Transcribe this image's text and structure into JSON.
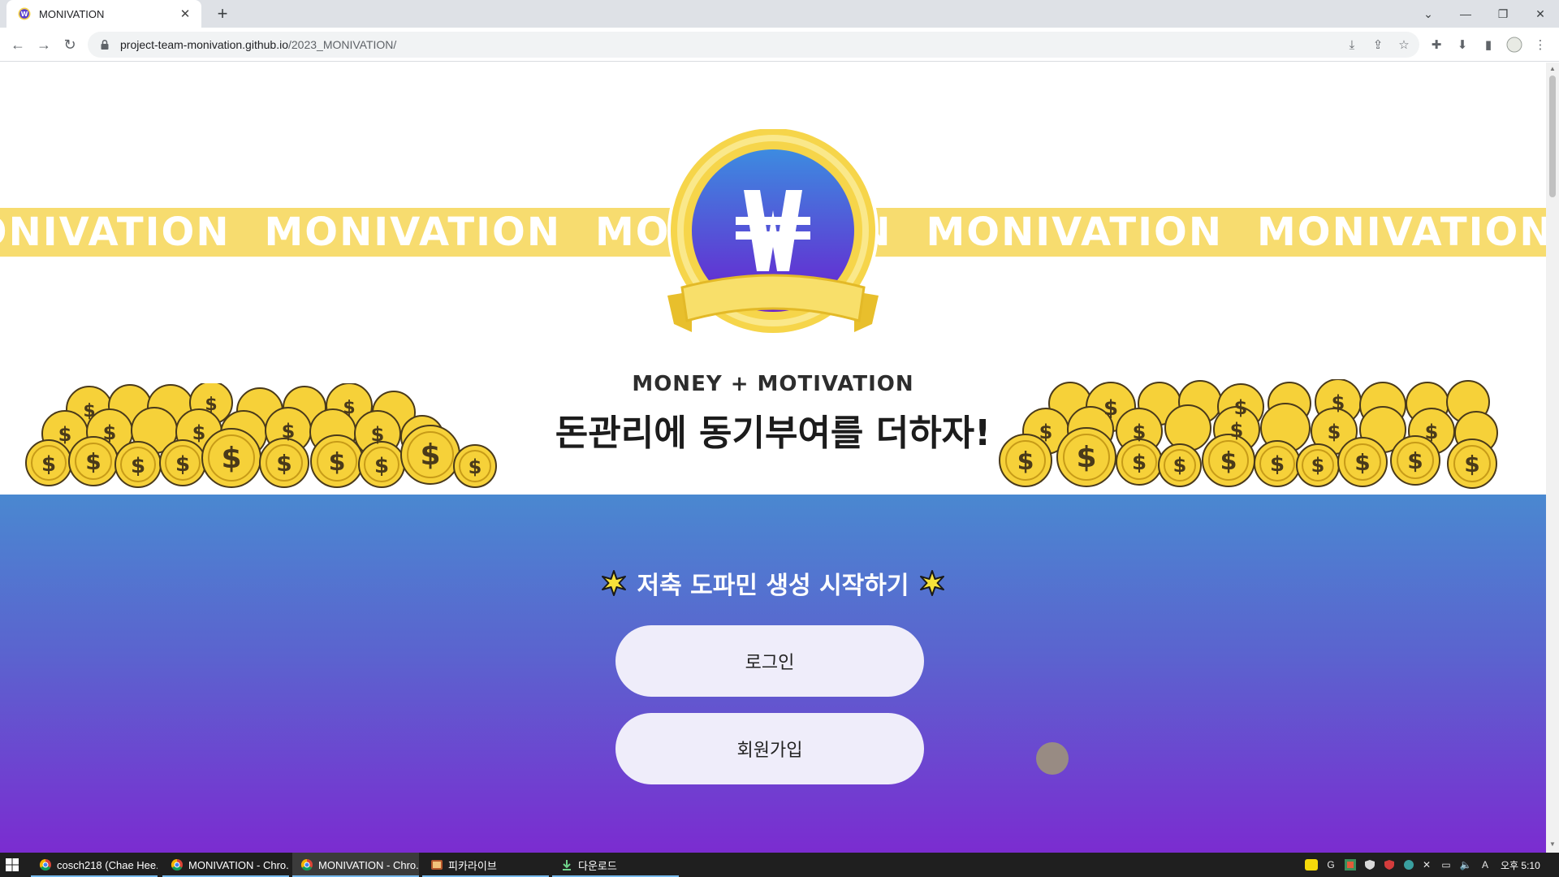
{
  "browser": {
    "tab_title": "MONIVATION",
    "new_tab": "+",
    "url_host": "project-team-monivation.github.io",
    "url_path": "/2023_MONIVATION/"
  },
  "page": {
    "marquee_word": "MONIVATION",
    "subtitle": "MONEY + MOTIVATION",
    "headline": "돈관리에 동기부여를 더하자!",
    "cta_heading": "저축 도파민 생성 시작하기",
    "login_label": "로그인",
    "signup_label": "회원가입",
    "accent_yellow": "#f7dc6f",
    "gradient_top": "#4a88d0",
    "gradient_bottom": "#7b2cd0"
  },
  "taskbar": {
    "items": [
      {
        "label": "cosch218 (Chae Hee..."
      },
      {
        "label": "MONIVATION - Chro..."
      },
      {
        "label": "MONIVATION - Chro..."
      },
      {
        "label": "피카라이브"
      },
      {
        "label": "다운로드"
      }
    ],
    "clock": "오후 5:10"
  }
}
